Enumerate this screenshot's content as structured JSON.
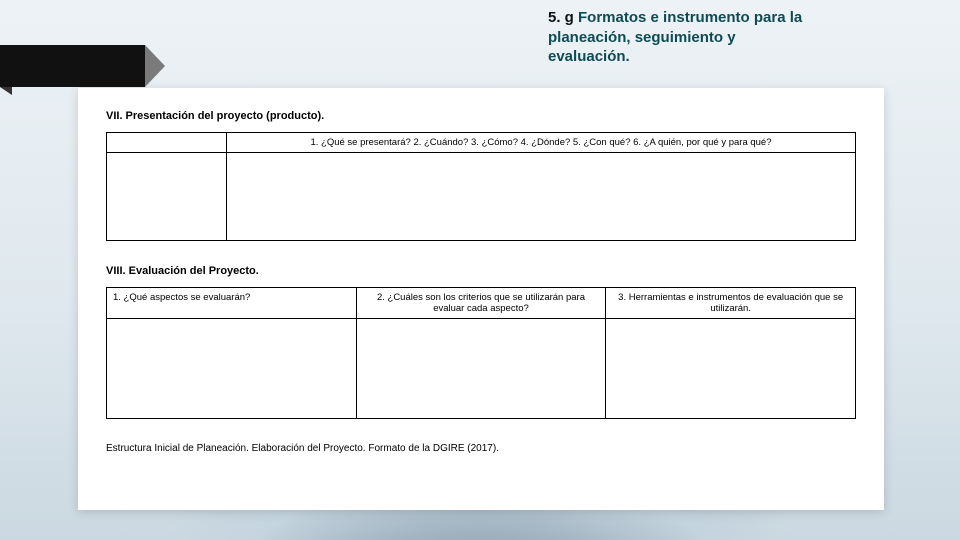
{
  "title": {
    "prefix": "5. g",
    "rest": " Formatos e instrumento para la planeación, seguimiento y evaluación."
  },
  "section_vii": {
    "heading": "VII. Presentación del proyecto (producto).",
    "questions": "1. ¿Qué se presentará?   2. ¿Cuándo?   3. ¿Cómo?   4. ¿Dónde?   5. ¿Con qué?   6. ¿A quién, por qué y para qué?"
  },
  "section_viii": {
    "heading": "VIII. Evaluación del Proyecto.",
    "col1": "1. ¿Qué aspectos se evaluarán?",
    "col2": "2. ¿Cuáles son los criterios que se utilizarán para evaluar cada aspecto?",
    "col3": "3. Herramientas e instrumentos de evaluación que se utilizarán."
  },
  "footer": "Estructura Inicial de Planeación. Elaboración del Proyecto. Formato de la DGIRE (2017)."
}
